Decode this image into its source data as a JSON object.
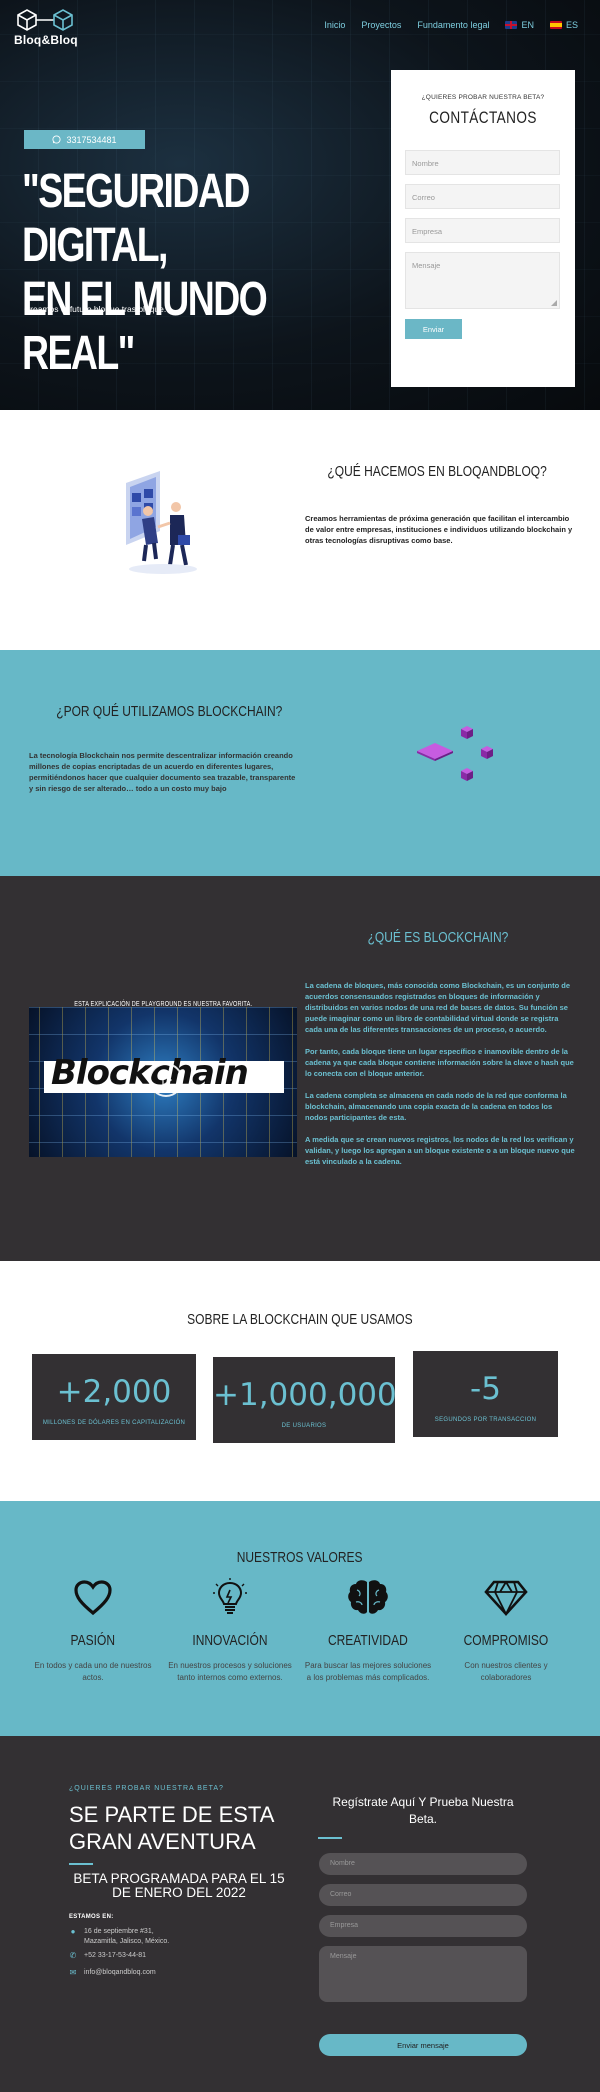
{
  "header": {
    "brand": "Bloq&Bloq",
    "nav": [
      "Inicio",
      "Proyectos",
      "Fundamento legal"
    ],
    "lang_en": "EN",
    "lang_es": "ES"
  },
  "hero": {
    "phone": "3317534481",
    "title_line1": "\"SEGURIDAD DIGITAL,",
    "title_line2": "EN EL MUNDO REAL\"",
    "subtitle": "Creamos el futuro bloque tras bloque."
  },
  "contact": {
    "kicker": "¿QUIERES PROBAR NUESTRA BETA?",
    "title": "CONTÁCTANOS",
    "name_placeholder": "Nombre",
    "email_placeholder": "Correo",
    "company_placeholder": "Empresa",
    "message_placeholder": "Mensaje",
    "submit": "Enviar"
  },
  "whatwedo": {
    "title": "¿QUÉ HACEMOS EN BLOQANDBLOQ?",
    "text": "Creamos herramientas de próxima generación que facilitan el intercambio de valor entre empresas, instituciones e individuos utilizando blockchain y otras tecnologías disruptivas como base."
  },
  "why": {
    "title": "¿POR QUÉ UTILIZAMOS BLOCKCHAIN?",
    "text": "La tecnología Blockchain nos permite descentralizar información creando millones de copias encriptadas de un acuerdo en diferentes lugares, permitiéndonos hacer que cualquier documento sea trazable, transparente y sin riesgo de ser alterado… todo a un costo muy bajo"
  },
  "whatis": {
    "title": "¿QUÉ ES BLOCKCHAIN?",
    "video_caption": "ESTA EXPLICACIÓN DE PLAYGROUND ES NUESTRA FAVORITA.",
    "video_word": "Blockchain",
    "paragraphs": [
      "La cadena de bloques, más conocida como Blockchain, es un conjunto de acuerdos consensuados registrados en bloques de información y distribuidos en varios nodos de una red de bases de datos. Su función se puede imaginar como un libro de contabilidad virtual donde se registra cada una de las diferentes transacciones de un proceso, o acuerdo.",
      "Por tanto, cada bloque tiene un lugar específico e inamovible dentro de la cadena ya que cada bloque contiene información sobre la clave o hash que lo conecta con el bloque anterior.",
      "La cadena completa se almacena en cada nodo de la red que conforma la blockchain, almacenando una copia exacta de la cadena en todos los nodos participantes de esta.",
      "A medida que se crean nuevos registros, los nodos de la red los verifican y validan, y luego los agregan a un bloque existente o a un bloque nuevo que está vinculado a la cadena."
    ]
  },
  "stats": {
    "title": "SOBRE LA BLOCKCHAIN QUE USAMOS",
    "items": [
      {
        "value": "+2,000",
        "label": "MILLONES DE DÓLARES EN CAPITALIZACIÓN"
      },
      {
        "value": "+1,000,000",
        "label": "DE USUARIOS"
      },
      {
        "value": "-5",
        "label": "SEGUNDOS POR TRANSACCION"
      }
    ]
  },
  "values": {
    "title": "NUESTROS VALORES",
    "items": [
      {
        "name": "PASIÓN",
        "icon": "heart-icon",
        "text": "En todos y cada uno de nuestros actos."
      },
      {
        "name": "INNOVACIÓN",
        "icon": "lightbulb-icon",
        "text": "En nuestros procesos y soluciones tanto internos como externos."
      },
      {
        "name": "CREATIVIDAD",
        "icon": "brain-icon",
        "text": "Para buscar las mejores soluciones a los problemas más complicados."
      },
      {
        "name": "COMPROMISO",
        "icon": "diamond-icon",
        "text": "Con nuestros clientes y colaboradores"
      }
    ]
  },
  "beta": {
    "kicker": "¿QUIERES PROBAR NUESTRA BETA?",
    "headline": "SE PARTE DE ESTA GRAN AVENTURA",
    "launch": "BETA PROGRAMADA PARA EL 15 DE ENERO DEL 2022",
    "location_heading": "ESTAMOS EN:",
    "address": "16 de septiembre #31, Mazamitla, Jalisco, México.",
    "phone": "+52 33-17-53-44-81",
    "email": "info@bloqandbloq.com",
    "form_title": "Regístrate Aquí Y Prueba Nuestra Beta.",
    "name_placeholder": "Nombre",
    "email_placeholder": "Correo",
    "company_placeholder": "Empresa",
    "message_placeholder": "Mensaje",
    "submit": "Enviar mensaje"
  },
  "colors": {
    "accent": "#67b8c7",
    "dark": "#333033",
    "cube_purple": "#a43ecf"
  }
}
